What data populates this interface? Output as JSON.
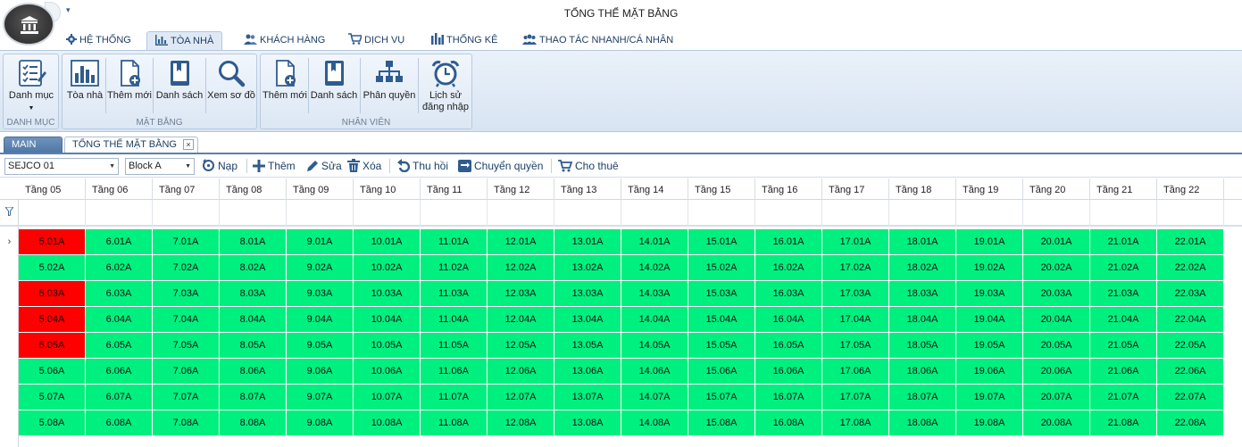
{
  "window": {
    "title": "TỔNG THỂ MẶT BẰNG"
  },
  "ribbon_tabs": [
    {
      "label": "HỆ THỐNG",
      "icon": "gear-icon"
    },
    {
      "label": "TÒA NHÀ",
      "icon": "bar-chart-icon",
      "active": true
    },
    {
      "label": "KHÁCH HÀNG",
      "icon": "users-icon"
    },
    {
      "label": "DỊCH VỤ",
      "icon": "cart-icon"
    },
    {
      "label": "THỐNG KÊ",
      "icon": "stats-icon"
    },
    {
      "label": "THAO TÁC NHANH/CÁ NHÂN",
      "icon": "people-icon"
    }
  ],
  "ribbon": {
    "groups": [
      {
        "label": "DANH MỤC",
        "buttons": [
          {
            "label": "Danh mục",
            "icon": "checklist-icon"
          }
        ]
      },
      {
        "label": "MẶT BẰNG",
        "buttons": [
          {
            "label": "Tòa nhà",
            "icon": "building-chart-icon"
          },
          {
            "label": "Thêm mới",
            "icon": "add-document-icon"
          },
          {
            "label": "Danh sách",
            "icon": "book-icon"
          },
          {
            "label": "Xem sơ đồ",
            "icon": "magnifier-icon"
          }
        ]
      },
      {
        "label": "NHÂN VIÊN",
        "buttons": [
          {
            "label": "Thêm mới",
            "icon": "add-document-icon"
          },
          {
            "label": "Danh sách",
            "icon": "book-icon"
          },
          {
            "label": "Phân quyền",
            "icon": "hierarchy-icon"
          },
          {
            "label": "Lịch sử đăng nhập",
            "label_line1": "Lịch sử",
            "label_line2": "đăng nhập",
            "icon": "alarm-clock-icon"
          }
        ]
      }
    ]
  },
  "doc_tabs": {
    "main": "MAIN",
    "current": "TỔNG THỂ MẶT BẰNG",
    "close": "×"
  },
  "toolbar": {
    "project_select": "SEJCO 01",
    "block_select": "Block A",
    "buttons": [
      {
        "label": "Nạp",
        "icon": "refresh-icon"
      },
      {
        "label": "Thêm",
        "icon": "plus-icon"
      },
      {
        "label": "Sửa",
        "icon": "pencil-icon"
      },
      {
        "label": "Xóa",
        "icon": "trash-icon"
      },
      {
        "label": "Thu hồi",
        "icon": "undo-icon"
      },
      {
        "label": "Chuyển quyền",
        "icon": "transfer-icon"
      },
      {
        "label": "Cho thuê",
        "icon": "cart-icon"
      }
    ]
  },
  "grid": {
    "columns": [
      "Tầng 05",
      "Tầng 06",
      "Tầng 07",
      "Tầng 08",
      "Tầng 09",
      "Tầng 10",
      "Tầng 11",
      "Tầng 12",
      "Tầng 13",
      "Tầng 14",
      "Tầng 15",
      "Tầng 16",
      "Tầng 17",
      "Tầng 18",
      "Tầng 19",
      "Tầng 20",
      "Tầng 21",
      "Tầng 22"
    ],
    "current_row_marker": "›",
    "colors": {
      "available": "#00f07f",
      "occupied": "#ff0000"
    },
    "rows": [
      {
        "cells": [
          "5.01A",
          "6.01A",
          "7.01A",
          "8.01A",
          "9.01A",
          "10.01A",
          "11.01A",
          "12.01A",
          "13.01A",
          "14.01A",
          "15.01A",
          "16.01A",
          "17.01A",
          "18.01A",
          "19.01A",
          "20.01A",
          "21.01A",
          "22.01A"
        ],
        "occupied": [
          0
        ]
      },
      {
        "cells": [
          "5.02A",
          "6.02A",
          "7.02A",
          "8.02A",
          "9.02A",
          "10.02A",
          "11.02A",
          "12.02A",
          "13.02A",
          "14.02A",
          "15.02A",
          "16.02A",
          "17.02A",
          "18.02A",
          "19.02A",
          "20.02A",
          "21.02A",
          "22.02A"
        ],
        "occupied": []
      },
      {
        "cells": [
          "5.03A",
          "6.03A",
          "7.03A",
          "8.03A",
          "9.03A",
          "10.03A",
          "11.03A",
          "12.03A",
          "13.03A",
          "14.03A",
          "15.03A",
          "16.03A",
          "17.03A",
          "18.03A",
          "19.03A",
          "20.03A",
          "21.03A",
          "22.03A"
        ],
        "occupied": [
          0
        ]
      },
      {
        "cells": [
          "5.04A",
          "6.04A",
          "7.04A",
          "8.04A",
          "9.04A",
          "10.04A",
          "11.04A",
          "12.04A",
          "13.04A",
          "14.04A",
          "15.04A",
          "16.04A",
          "17.04A",
          "18.04A",
          "19.04A",
          "20.04A",
          "21.04A",
          "22.04A"
        ],
        "occupied": [
          0
        ]
      },
      {
        "cells": [
          "5.05A",
          "6.05A",
          "7.05A",
          "8.05A",
          "9.05A",
          "10.05A",
          "11.05A",
          "12.05A",
          "13.05A",
          "14.05A",
          "15.05A",
          "16.05A",
          "17.05A",
          "18.05A",
          "19.05A",
          "20.05A",
          "21.05A",
          "22.05A"
        ],
        "occupied": [
          0
        ]
      },
      {
        "cells": [
          "5.06A",
          "6.06A",
          "7.06A",
          "8.06A",
          "9.06A",
          "10.06A",
          "11.06A",
          "12.06A",
          "13.06A",
          "14.06A",
          "15.06A",
          "16.06A",
          "17.06A",
          "18.06A",
          "19.06A",
          "20.06A",
          "21.06A",
          "22.06A"
        ],
        "occupied": []
      },
      {
        "cells": [
          "5.07A",
          "6.07A",
          "7.07A",
          "8.07A",
          "9.07A",
          "10.07A",
          "11.07A",
          "12.07A",
          "13.07A",
          "14.07A",
          "15.07A",
          "16.07A",
          "17.07A",
          "18.07A",
          "19.07A",
          "20.07A",
          "21.07A",
          "22.07A"
        ],
        "occupied": []
      },
      {
        "cells": [
          "5.08A",
          "6.08A",
          "7.08A",
          "8.08A",
          "9.08A",
          "10.08A",
          "11.08A",
          "12.08A",
          "13.08A",
          "14.08A",
          "15.08A",
          "16.08A",
          "17.08A",
          "18.08A",
          "19.08A",
          "20.08A",
          "21.08A",
          "22.08A"
        ],
        "occupied": []
      }
    ]
  }
}
